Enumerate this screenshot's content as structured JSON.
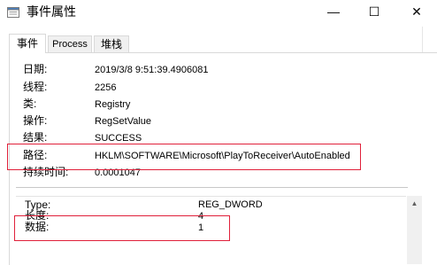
{
  "window": {
    "title": "事件属性",
    "minimize_glyph": "—",
    "maximize_glyph": "☐",
    "close_glyph": "✕"
  },
  "tabs": [
    {
      "label": "事件"
    },
    {
      "label": "Process"
    },
    {
      "label": "堆栈"
    }
  ],
  "event": {
    "fields": [
      {
        "label": "日期:",
        "value": "2019/3/8 9:51:39.4906081"
      },
      {
        "label": "线程:",
        "value": "2256"
      },
      {
        "label": "类:",
        "value": "Registry"
      },
      {
        "label": "操作:",
        "value": "RegSetValue"
      },
      {
        "label": "结果:",
        "value": "SUCCESS"
      },
      {
        "label": "路径:",
        "value": "HKLM\\SOFTWARE\\Microsoft\\PlayToReceiver\\AutoEnabled"
      },
      {
        "label": "持续时间:",
        "value": "0.0001047"
      }
    ],
    "details": [
      {
        "label": "Type:",
        "value": "REG_DWORD"
      },
      {
        "label": "长度:",
        "value": "4"
      },
      {
        "label": "数据:",
        "value": "1"
      }
    ]
  },
  "colors": {
    "highlight_box": "#e0203a"
  },
  "icons": {
    "app": "document-icon",
    "scroll_up": "chevron-up-icon"
  }
}
